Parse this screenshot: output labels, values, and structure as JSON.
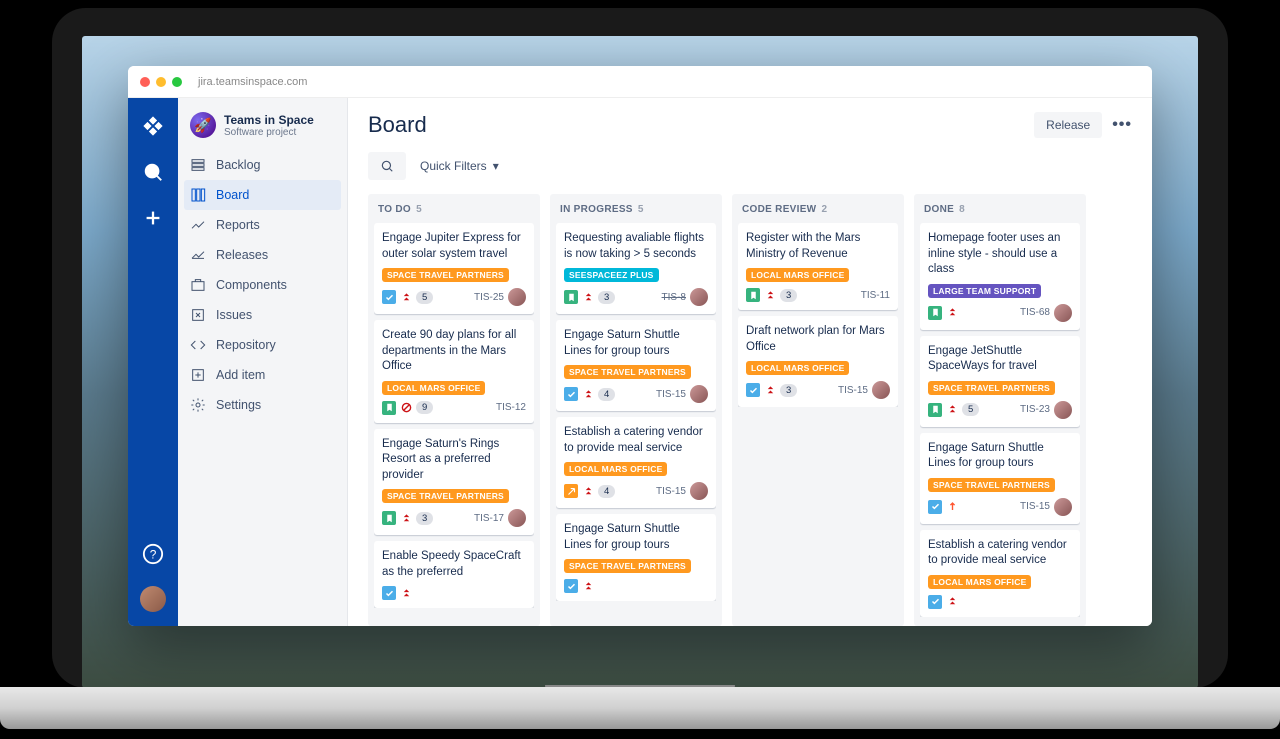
{
  "browser": {
    "url": "jira.teamsinspace.com"
  },
  "project": {
    "name": "Teams in Space",
    "type": "Software project"
  },
  "sidebar": {
    "items": [
      {
        "label": "Backlog"
      },
      {
        "label": "Board"
      },
      {
        "label": "Reports"
      },
      {
        "label": "Releases"
      },
      {
        "label": "Components"
      },
      {
        "label": "Issues"
      },
      {
        "label": "Repository"
      },
      {
        "label": "Add item"
      },
      {
        "label": "Settings"
      }
    ]
  },
  "header": {
    "title": "Board",
    "release_label": "Release",
    "quick_filters": "Quick Filters"
  },
  "columns": [
    {
      "name": "TO DO",
      "count": "5",
      "cards": [
        {
          "title": "Engage Jupiter Express for outer solar system travel",
          "tag": "SPACE TRAVEL PARTNERS",
          "tagColor": "orange",
          "type": "task",
          "prio": "highest",
          "est": "5",
          "key": "TIS-25",
          "avatar": true
        },
        {
          "title": "Create 90 day plans for all departments in the Mars Office",
          "tag": "LOCAL MARS OFFICE",
          "tagColor": "orange",
          "type": "story",
          "prio": "blocker",
          "est": "9",
          "key": "TIS-12",
          "avatar": false
        },
        {
          "title": "Engage Saturn's Rings Resort as a preferred provider",
          "tag": "SPACE TRAVEL PARTNERS",
          "tagColor": "orange",
          "type": "story",
          "prio": "highest",
          "est": "3",
          "key": "TIS-17",
          "avatar": true
        },
        {
          "title": "Enable Speedy SpaceCraft as the preferred",
          "tag": "",
          "tagColor": "teal",
          "type": "task",
          "prio": "highest",
          "est": "",
          "key": "",
          "avatar": false
        }
      ]
    },
    {
      "name": "IN PROGRESS",
      "count": "5",
      "cards": [
        {
          "title": "Requesting avaliable flights is now taking > 5 seconds",
          "tag": "SEESPACEEZ PLUS",
          "tagColor": "teal",
          "type": "story",
          "prio": "highest",
          "est": "3",
          "key": "TIS-8",
          "keyStrike": true,
          "avatar": true
        },
        {
          "title": "Engage Saturn Shuttle Lines for group tours",
          "tag": "SPACE TRAVEL PARTNERS",
          "tagColor": "orange",
          "type": "task",
          "prio": "highest",
          "est": "4",
          "key": "TIS-15",
          "avatar": true
        },
        {
          "title": "Establish a catering vendor to provide meal service",
          "tag": "LOCAL MARS OFFICE",
          "tagColor": "orange",
          "type": "change",
          "prio": "highest",
          "est": "4",
          "key": "TIS-15",
          "avatar": true
        },
        {
          "title": "Engage Saturn Shuttle Lines for group tours",
          "tag": "SPACE TRAVEL PARTNERS",
          "tagColor": "orange",
          "type": "task",
          "prio": "highest",
          "est": "",
          "key": "",
          "avatar": false
        }
      ]
    },
    {
      "name": "CODE REVIEW",
      "count": "2",
      "cards": [
        {
          "title": "Register with the Mars Ministry of Revenue",
          "tag": "LOCAL MARS OFFICE",
          "tagColor": "orange",
          "type": "story",
          "prio": "highest",
          "est": "3",
          "key": "TIS-11",
          "avatar": false
        },
        {
          "title": "Draft network plan for Mars Office",
          "tag": "LOCAL MARS OFFICE",
          "tagColor": "orange",
          "type": "task",
          "prio": "highest",
          "est": "3",
          "key": "TIS-15",
          "avatar": true
        }
      ]
    },
    {
      "name": "DONE",
      "count": "8",
      "cards": [
        {
          "title": "Homepage footer uses an inline style - should use a class",
          "tag": "LARGE TEAM SUPPORT",
          "tagColor": "purple",
          "type": "story",
          "prio": "highest",
          "est": "",
          "key": "TIS-68",
          "avatar": true
        },
        {
          "title": "Engage JetShuttle SpaceWays for travel",
          "tag": "SPACE TRAVEL PARTNERS",
          "tagColor": "orange",
          "type": "story",
          "prio": "highest",
          "est": "5",
          "key": "TIS-23",
          "avatar": true
        },
        {
          "title": "Engage Saturn Shuttle Lines for group tours",
          "tag": "SPACE TRAVEL PARTNERS",
          "tagColor": "orange",
          "type": "task",
          "prio": "medium",
          "est": "",
          "key": "TIS-15",
          "avatar": true
        },
        {
          "title": "Establish a catering vendor to provide meal service",
          "tag": "LOCAL MARS OFFICE",
          "tagColor": "orange",
          "type": "task",
          "prio": "highest",
          "est": "",
          "key": "",
          "avatar": false
        }
      ]
    }
  ]
}
